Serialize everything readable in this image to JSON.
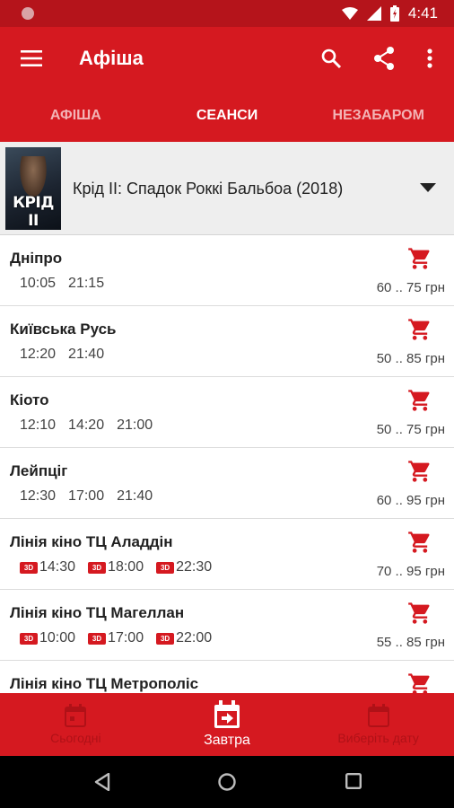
{
  "status_bar": {
    "time": "4:41"
  },
  "toolbar": {
    "title": "Афіша",
    "icons": [
      "menu-icon",
      "search-icon",
      "share-icon",
      "more-vert-icon"
    ]
  },
  "tabs": [
    {
      "label": "АФІША",
      "active": false
    },
    {
      "label": "СЕАНСИ",
      "active": true
    },
    {
      "label": "НЕЗАБАРОМ",
      "active": false
    }
  ],
  "movie": {
    "title": "Крід ІІ: Спадок Роккі Бальбоа (2018)",
    "poster_text": "КРІД ІІ"
  },
  "cinemas": [
    {
      "name": "Дніпро",
      "price": "60 .. 75 грн",
      "sessions": [
        {
          "time": "10:05",
          "is3d": false
        },
        {
          "time": "21:15",
          "is3d": false
        }
      ]
    },
    {
      "name": "Київська Русь",
      "price": "50 .. 85 грн",
      "sessions": [
        {
          "time": "12:20",
          "is3d": false
        },
        {
          "time": "21:40",
          "is3d": false
        }
      ]
    },
    {
      "name": "Кіото",
      "price": "50 .. 75 грн",
      "sessions": [
        {
          "time": "12:10",
          "is3d": false
        },
        {
          "time": "14:20",
          "is3d": false
        },
        {
          "time": "21:00",
          "is3d": false
        }
      ]
    },
    {
      "name": "Лейпціг",
      "price": "60 .. 95 грн",
      "sessions": [
        {
          "time": "12:30",
          "is3d": false
        },
        {
          "time": "17:00",
          "is3d": false
        },
        {
          "time": "21:40",
          "is3d": false
        }
      ]
    },
    {
      "name": "Лінія кіно ТЦ Аладдін",
      "price": "70 .. 95 грн",
      "sessions": [
        {
          "time": "14:30",
          "is3d": true
        },
        {
          "time": "18:00",
          "is3d": true
        },
        {
          "time": "22:30",
          "is3d": true
        }
      ]
    },
    {
      "name": "Лінія кіно ТЦ Магеллан",
      "price": "55 .. 85 грн",
      "sessions": [
        {
          "time": "10:00",
          "is3d": true
        },
        {
          "time": "17:00",
          "is3d": true
        },
        {
          "time": "22:00",
          "is3d": true
        }
      ]
    },
    {
      "name": "Лінія кіно ТЦ Метрополіс",
      "price": "",
      "sessions": []
    }
  ],
  "badge_3d_label": "3D",
  "bottom_nav": [
    {
      "label": "Сьогодні",
      "active": false
    },
    {
      "label": "Завтра",
      "active": true
    },
    {
      "label": "Виберіть дату",
      "active": false
    }
  ],
  "colors": {
    "primary": "#d51920",
    "status": "#b5141b",
    "inactive_tab": "#f3b3b5"
  }
}
